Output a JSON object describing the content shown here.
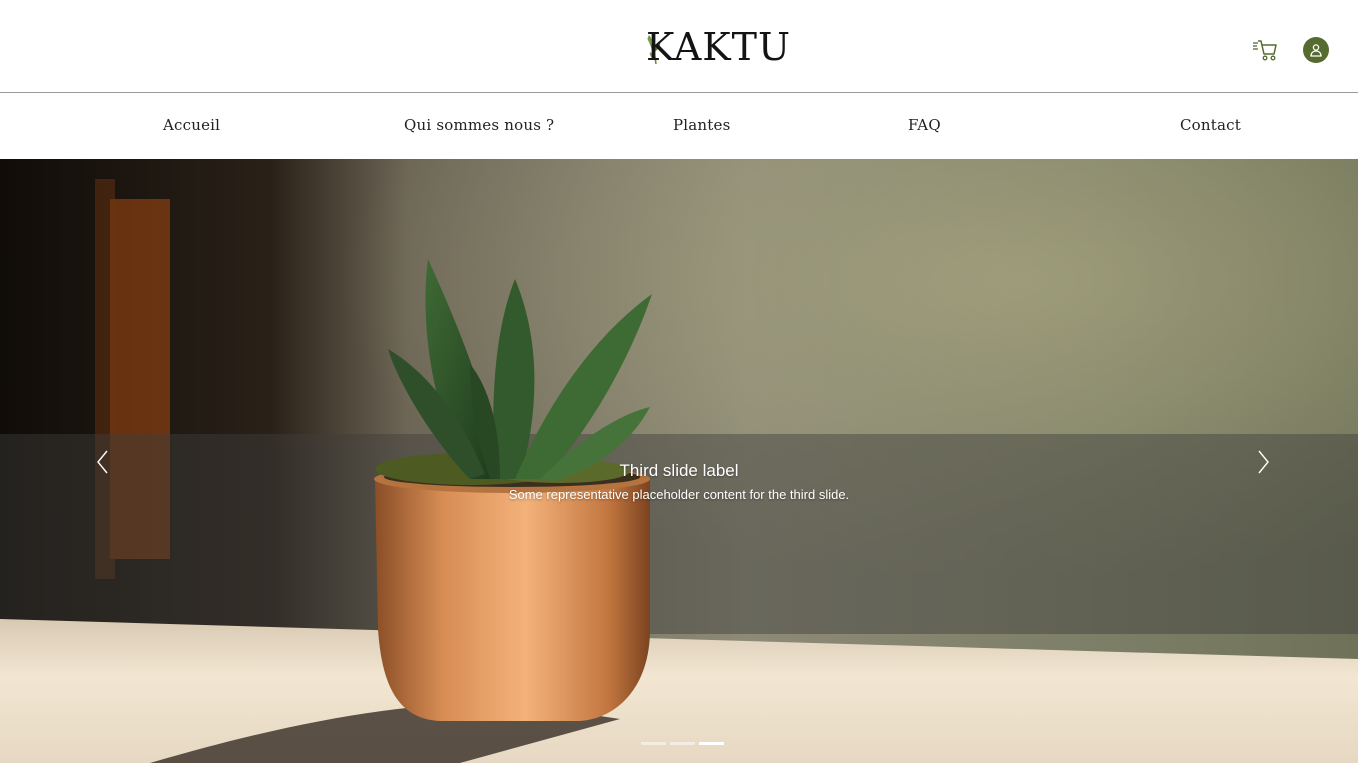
{
  "header": {
    "logo": "KAKTU",
    "cart_icon": "cart-icon",
    "account_icon": "user-icon",
    "accent_color": "#556b2f"
  },
  "nav": {
    "items": [
      {
        "label": "Accueil"
      },
      {
        "label": "Qui sommes nous ?"
      },
      {
        "label": "Plantes"
      },
      {
        "label": "FAQ"
      },
      {
        "label": "Contact"
      }
    ]
  },
  "carousel": {
    "caption_title": "Third slide label",
    "caption_text": "Some representative placeholder content for the third slide.",
    "prev_icon": "chevron-left-icon",
    "next_icon": "chevron-right-icon",
    "slide_count": 3,
    "active_slide": 3
  }
}
